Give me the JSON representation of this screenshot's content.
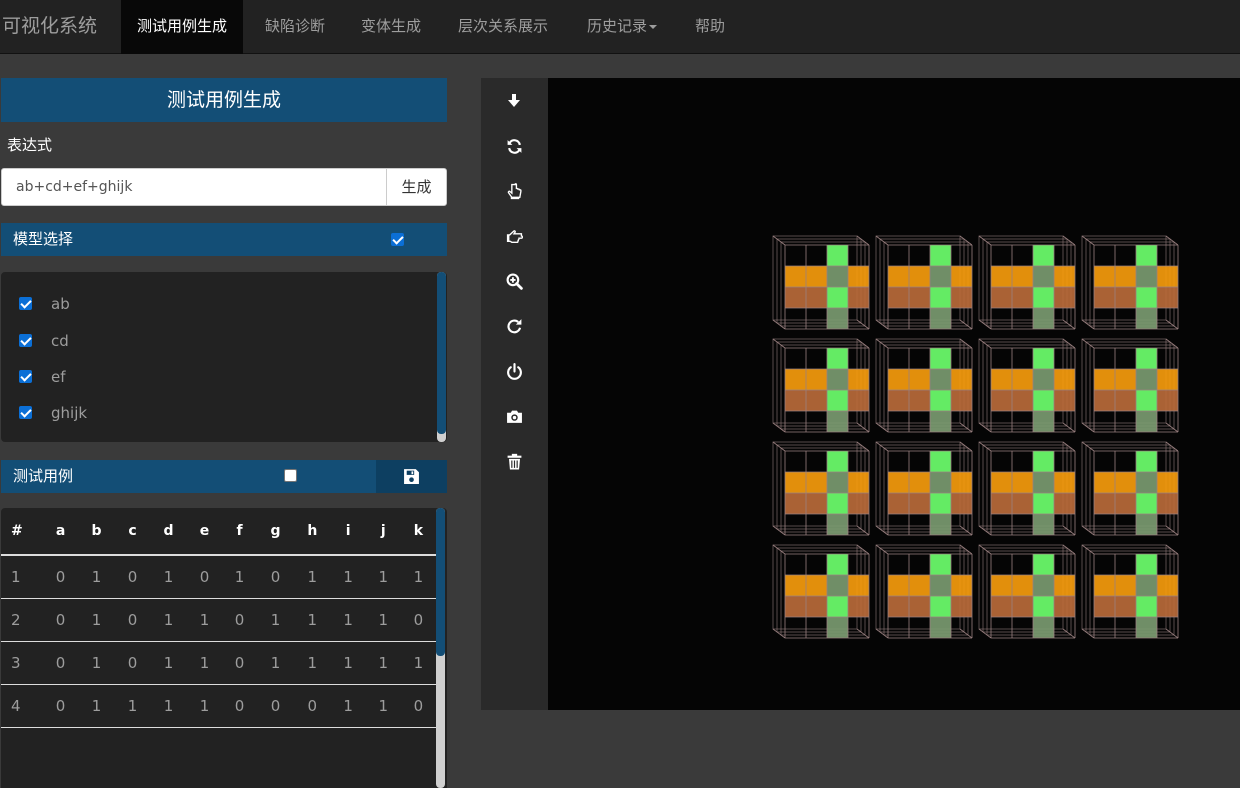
{
  "navbar": {
    "brand": "可视化系统",
    "items": [
      {
        "label": "测试用例生成",
        "active": true
      },
      {
        "label": "缺陷诊断"
      },
      {
        "label": "变体生成"
      },
      {
        "label": "层次关系展示"
      },
      {
        "label": "历史记录",
        "dropdown": true
      },
      {
        "label": "帮助"
      }
    ]
  },
  "panel": {
    "title": "测试用例生成",
    "expression_label": "表达式",
    "expression_value": "ab+cd+ef+ghijk",
    "generate_label": "生成",
    "model_label": "模型选择",
    "model_all_checked": true,
    "models": [
      {
        "label": "ab",
        "checked": true
      },
      {
        "label": "cd",
        "checked": true
      },
      {
        "label": "ef",
        "checked": true
      },
      {
        "label": "ghijk",
        "checked": true
      }
    ],
    "tests_label": "测试用例",
    "tests_all_checked": false,
    "save_icon": "save-icon"
  },
  "table": {
    "headers": [
      "#",
      "a",
      "b",
      "c",
      "d",
      "e",
      "f",
      "g",
      "h",
      "i",
      "j",
      "k"
    ],
    "rows": [
      [
        "1",
        "0",
        "1",
        "0",
        "1",
        "0",
        "1",
        "0",
        "1",
        "1",
        "1",
        "1"
      ],
      [
        "2",
        "0",
        "1",
        "0",
        "1",
        "1",
        "0",
        "1",
        "1",
        "1",
        "1",
        "0"
      ],
      [
        "3",
        "0",
        "1",
        "0",
        "1",
        "1",
        "0",
        "1",
        "1",
        "1",
        "1",
        "1"
      ],
      [
        "4",
        "0",
        "1",
        "1",
        "1",
        "1",
        "0",
        "0",
        "0",
        "1",
        "1",
        "0"
      ]
    ]
  },
  "toolbar": {
    "icons": [
      "download-icon",
      "sync-icon",
      "hand-pointer-icon",
      "hand-point-right-icon",
      "zoom-in-icon",
      "refresh-icon",
      "power-icon",
      "camera-icon",
      "trash-icon"
    ]
  },
  "colors": {
    "navbar_bg": "#222222",
    "panel_blue": "#134e76",
    "canvas_bg": "#050505",
    "cell_orange": "#f59b0d",
    "cell_brown": "#b86a3a",
    "cell_green": "#6dff6d",
    "cell_gray_green": "#7a9a70",
    "wire": "#9a8080"
  }
}
